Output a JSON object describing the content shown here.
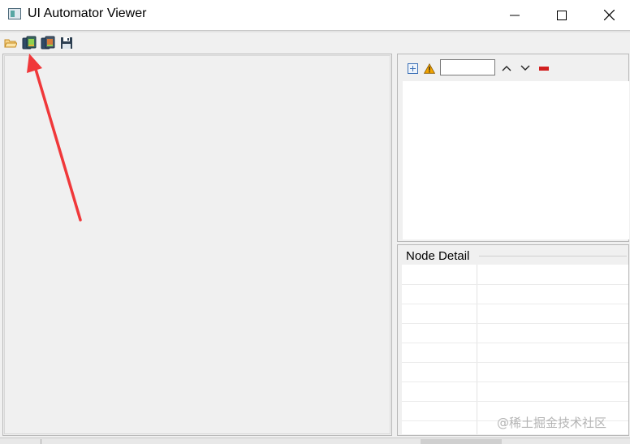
{
  "window": {
    "title": "UI Automator Viewer"
  },
  "toolbar": {
    "items": [
      {
        "name": "open-icon",
        "tooltip": ""
      },
      {
        "name": "device-screenshot-icon"
      },
      {
        "name": "device-screenshot-compressed-icon"
      },
      {
        "name": "save-icon"
      }
    ]
  },
  "hierarchy_toolbar": {
    "search_value": "",
    "icons": [
      "expand-all-icon",
      "warning-icon",
      "chevron-up-icon",
      "chevron-down-icon",
      "clear-icon"
    ]
  },
  "node_detail": {
    "title": "Node Detail"
  },
  "watermark": "@稀土掘金技术社区",
  "colors": {
    "arrow": "#f0383a",
    "clear": "#d11f1f",
    "warning": "#f2a400"
  }
}
